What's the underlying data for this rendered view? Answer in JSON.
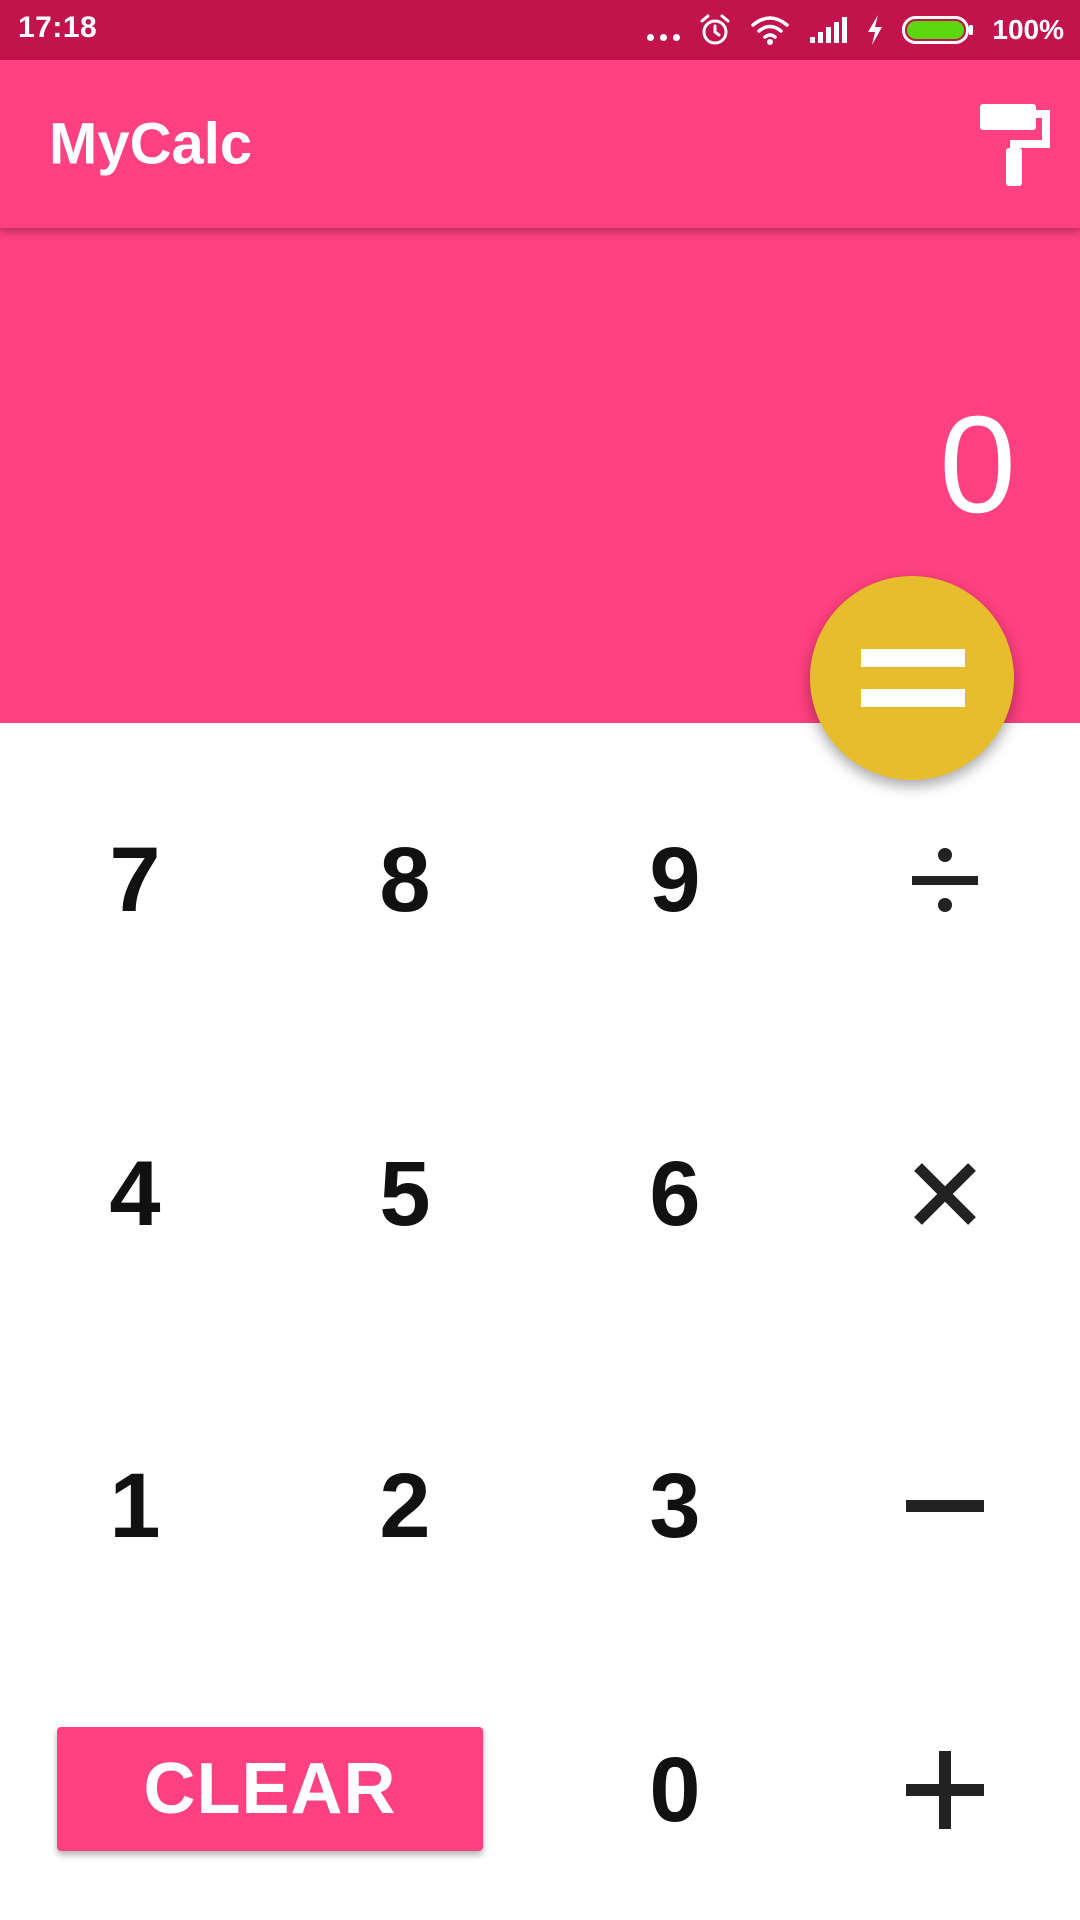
{
  "status_bar": {
    "time": "17:18",
    "battery_percent": "100%",
    "battery_level": 1.0,
    "icons": [
      "more-dots-icon",
      "alarm-icon",
      "wifi-icon",
      "cell-signal-icon",
      "charging-bolt-icon",
      "battery-icon"
    ]
  },
  "app_bar": {
    "title": "MyCalc",
    "action_icon": "paint-roller-icon"
  },
  "display": {
    "value": "0"
  },
  "keypad": {
    "rows": [
      [
        "7",
        "8",
        "9",
        "divide-icon"
      ],
      [
        "4",
        "5",
        "6",
        "multiply-icon"
      ],
      [
        "1",
        "2",
        "3",
        "minus-icon"
      ],
      [
        "CLEAR",
        "0",
        "plus-icon"
      ]
    ],
    "digits": {
      "seven": "7",
      "eight": "8",
      "nine": "9",
      "four": "4",
      "five": "5",
      "six": "6",
      "one": "1",
      "two": "2",
      "three": "3",
      "zero": "0"
    },
    "clear_label": "CLEAR",
    "equals_icon": "equals-icon"
  },
  "colors": {
    "status_bar": "#c2134c",
    "primary": "#ff4081",
    "accent": "#e8bd2d",
    "text_dark": "#111111",
    "operator": "#222222",
    "battery": "#5cd60f"
  }
}
